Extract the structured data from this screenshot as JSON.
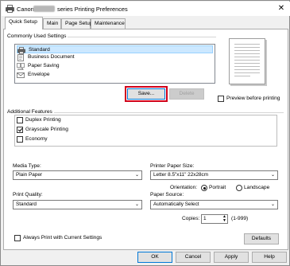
{
  "window": {
    "title_prefix": "Canon",
    "title_suffix": "series Printing Preferences",
    "close_glyph": "✕"
  },
  "tabs": [
    {
      "label": "Quick Setup",
      "active": true
    },
    {
      "label": "Main",
      "active": false
    },
    {
      "label": "Page Setup",
      "active": false
    },
    {
      "label": "Maintenance",
      "active": false
    }
  ],
  "commonly_used": {
    "title": "Commonly Used Settings",
    "items": [
      {
        "label": "Standard",
        "icon": "printer-icon",
        "selected": true
      },
      {
        "label": "Business Document",
        "icon": "document-icon",
        "selected": false
      },
      {
        "label": "Paper Saving",
        "icon": "paper-saving-icon",
        "selected": false
      },
      {
        "label": "Envelope",
        "icon": "envelope-icon",
        "selected": false
      }
    ],
    "save_label": "Save...",
    "delete_label": "Delete"
  },
  "preview": {
    "checkbox_label": "Preview before printing",
    "checked": false
  },
  "additional_features": {
    "title": "Additional Features",
    "items": [
      {
        "label": "Duplex Printing",
        "checked": false
      },
      {
        "label": "Grayscale Printing",
        "checked": true
      },
      {
        "label": "Economy",
        "checked": false
      }
    ]
  },
  "media_type": {
    "label": "Media Type:",
    "value": "Plain Paper"
  },
  "paper_size": {
    "label": "Printer Paper Size:",
    "value": "Letter 8.5\"x11\" 22x28cm"
  },
  "orientation": {
    "label": "Orientation:",
    "portrait": "Portrait",
    "landscape": "Landscape",
    "selected": "Portrait"
  },
  "print_quality": {
    "label": "Print Quality:",
    "value": "Standard"
  },
  "paper_source": {
    "label": "Paper Source:",
    "value": "Automatically Select"
  },
  "copies": {
    "label": "Copies:",
    "value": "1",
    "range": "(1-999)"
  },
  "always_print": {
    "label": "Always Print with Current Settings",
    "checked": false
  },
  "defaults_label": "Defaults",
  "footer": {
    "ok": "OK",
    "cancel": "Cancel",
    "apply": "Apply",
    "help": "Help"
  },
  "colors": {
    "highlight": "#d0021b",
    "selection": "#cce8ff",
    "accent": "#0078d7"
  }
}
